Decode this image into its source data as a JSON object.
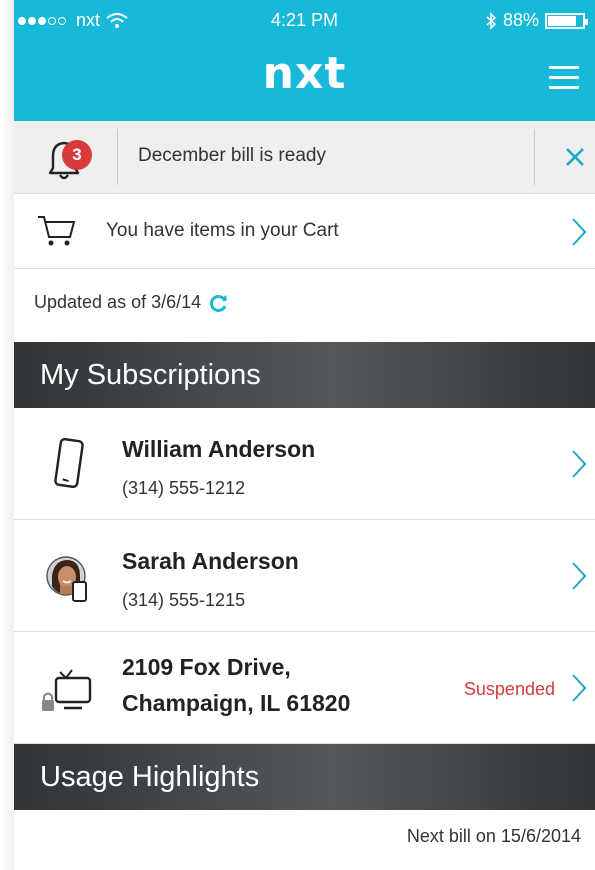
{
  "status_bar": {
    "carrier": "nxt",
    "time": "4:21 PM",
    "battery": "88%",
    "signal_bars_filled": 3,
    "signal_bars_total": 5
  },
  "header": {
    "logo": "nxt",
    "accent_color": "#18b8d8"
  },
  "notification": {
    "badge_count": "3",
    "message": "December bill is ready"
  },
  "cart": {
    "message": "You have items in your Cart"
  },
  "updated": {
    "text": "Updated as of 3/6/14"
  },
  "subscriptions": {
    "title": "My Subscriptions",
    "items": [
      {
        "name": "William Anderson",
        "detail": "(314) 555-1212",
        "icon": "mobile-phone-icon"
      },
      {
        "name": "Sarah Anderson",
        "detail": "(314) 555-1215",
        "icon": "avatar-photo"
      },
      {
        "name_line1": "2109 Fox Drive,",
        "name_line2": "Champaign, IL 61820",
        "status": "Suspended",
        "icon": "tv-lock-icon"
      }
    ]
  },
  "usage": {
    "title": "Usage Highlights",
    "next_bill": "Next bill on 15/6/2014"
  },
  "colors": {
    "suspended": "#d23b3b",
    "badge": "#d63a3a",
    "section_bg": "#3f4547"
  }
}
